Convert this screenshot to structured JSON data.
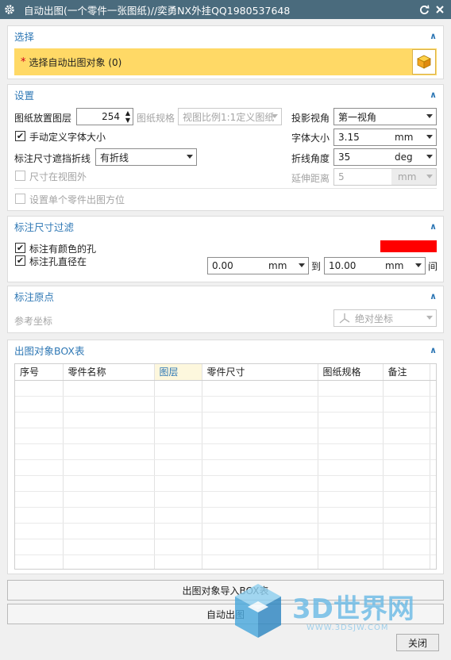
{
  "window": {
    "title": "自动出图(一个零件一张图纸)//奕勇NX外挂QQ1980537648",
    "refresh_icon": "refresh-icon",
    "close_icon": "close-icon"
  },
  "select_section": {
    "header": "选择",
    "required_mark": "*",
    "select_label": "选择自动出图对象 (0)",
    "selector_icon": "cube-icon",
    "highlight_color": "#ffd966"
  },
  "settings": {
    "header": "设置",
    "layer_label": "图纸放置图层",
    "layer_value": "254",
    "sheet_spec_label": "图纸规格",
    "sheet_spec_value": "视图比例1:1定义图纸",
    "projection_label": "投影视角",
    "projection_value": "第一视角",
    "custom_font_label": "手动定义字体大小",
    "custom_font_checked": true,
    "font_size_label": "字体大小",
    "font_size_value": "3.15",
    "font_size_unit": "mm",
    "dim_break_label": "标注尺寸遮挡折线",
    "dim_break_value": "有折线",
    "fold_angle_label": "折线角度",
    "fold_angle_value": "35",
    "fold_angle_unit": "deg",
    "outside_view_label": "尺寸在视图外",
    "outside_view_checked": false,
    "extend_label": "延伸距离",
    "extend_value": "5",
    "extend_unit": "mm",
    "single_orient_label": "设置单个零件出图方位",
    "single_orient_checked": false
  },
  "filter": {
    "header": "标注尺寸过滤",
    "colored_hole_label": "标注有颜色的孔",
    "colored_hole_checked": true,
    "hole_color": "#ff0000",
    "hole_dia_label": "标注孔直径在",
    "hole_dia_checked": true,
    "min_value": "0.00",
    "min_unit": "mm",
    "to_label": "到",
    "max_value": "10.00",
    "max_unit": "mm",
    "between_label": "间"
  },
  "origin": {
    "header": "标注原点",
    "ref_label": "参考坐标",
    "ref_value": "绝对坐标",
    "ref_icon": "coordinate-axes-icon"
  },
  "box_table": {
    "header": "出图对象BOX表",
    "columns": [
      "序号",
      "零件名称",
      "图层",
      "零件尺寸",
      "图纸规格",
      "备注"
    ],
    "active_column": 2,
    "rows": []
  },
  "actions": {
    "import_label": "出图对象导入BOX表",
    "auto_label": "自动出图",
    "close_label": "关闭"
  },
  "watermark": {
    "text": "3D世界网",
    "url": "WWW.3DSJW.COM"
  }
}
